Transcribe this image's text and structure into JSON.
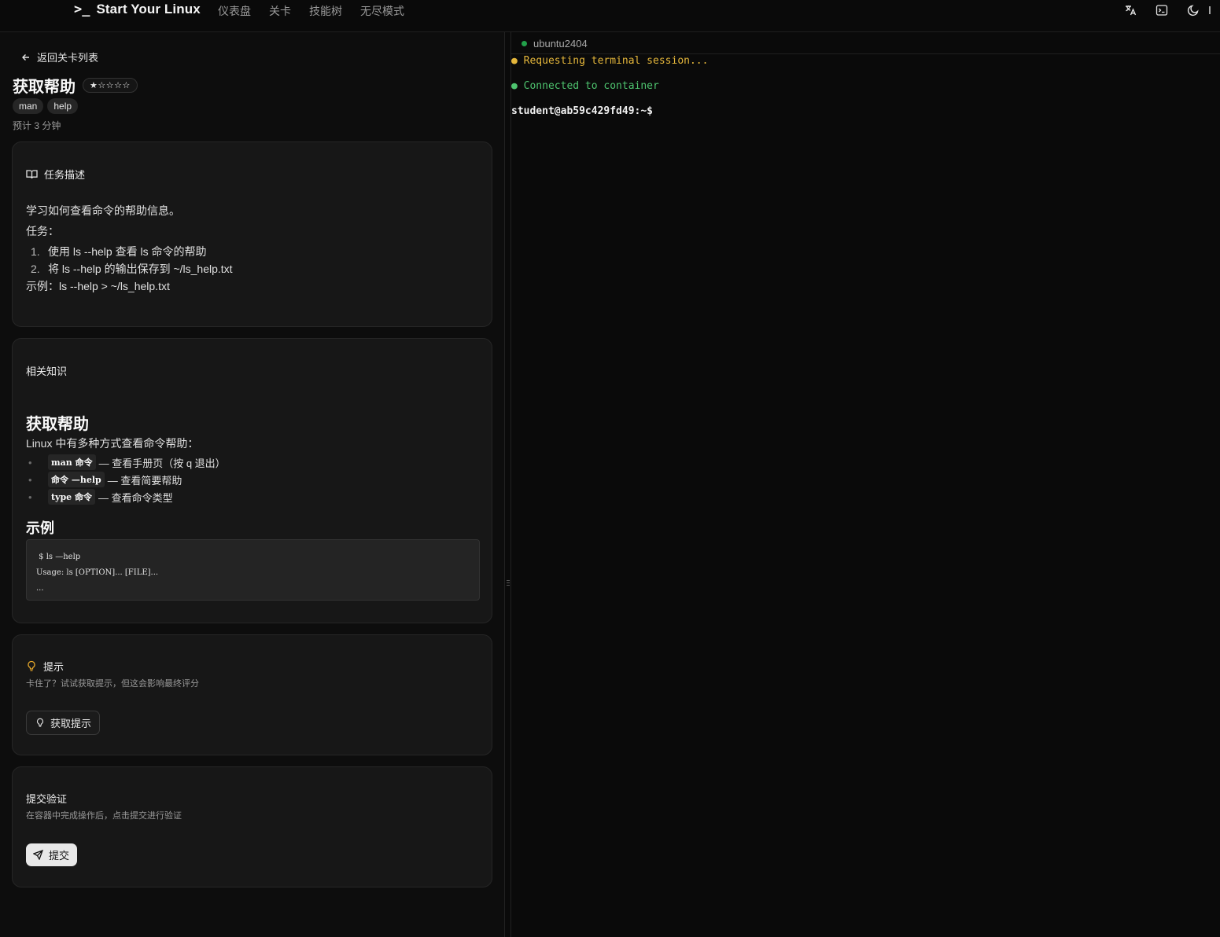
{
  "app": {
    "brand_icon": ">_",
    "brand_name": "Start Your Linux",
    "nav": [
      "仪表盘",
      "关卡",
      "技能树",
      "无尽模式"
    ],
    "nav_icons": [
      "translate-icon",
      "terminal-icon",
      "moon-icon"
    ]
  },
  "level": {
    "back_label": "返回关卡列表",
    "title": "获取帮助",
    "stars": "★☆☆☆☆",
    "tags": [
      "man",
      "help"
    ],
    "eta": "预计 3 分钟"
  },
  "task": {
    "heading": "任务描述",
    "intro": "学习如何查看命令的帮助信息。",
    "tasks_label": "任务：",
    "steps": [
      {
        "num": "1.",
        "text": "使用 ls --help 查看 ls 命令的帮助"
      },
      {
        "num": "2.",
        "text": "将 ls --help 的输出保存到 ~/ls_help.txt"
      }
    ],
    "example": "示例：ls --help > ~/ls_help.txt"
  },
  "knowledge": {
    "heading": "相关知识",
    "h_help": "获取帮助",
    "p_help": "Linux 中有多种方式查看命令帮助：",
    "items": [
      {
        "code": "man 命令",
        "text": "— 查看手册页（按 q 退出）"
      },
      {
        "code": "命令 —help",
        "text": "— 查看简要帮助"
      },
      {
        "code": "type 命令",
        "text": "— 查看命令类型"
      }
    ],
    "h_example": "示例",
    "code_lines": [
      " $ ls —help",
      "Usage: ls [OPTION]... [FILE]...",
      "..."
    ]
  },
  "hint": {
    "heading": "提示",
    "sub": "卡住了？试试获取提示，但这会影响最终评分",
    "button": "获取提示"
  },
  "submit": {
    "heading": "提交验证",
    "sub": "在容器中完成操作后，点击提交进行验证",
    "button": "提交"
  },
  "terminal": {
    "tab_name": "ubuntu2404",
    "lines": [
      {
        "text": "● Requesting terminal session...",
        "color": "#e5b73b"
      },
      {
        "text": "● Connected to container",
        "color": "#4ec46f"
      },
      {
        "text": "student@ab59c429fd49:~$",
        "color": "#f0f0f0"
      }
    ]
  }
}
